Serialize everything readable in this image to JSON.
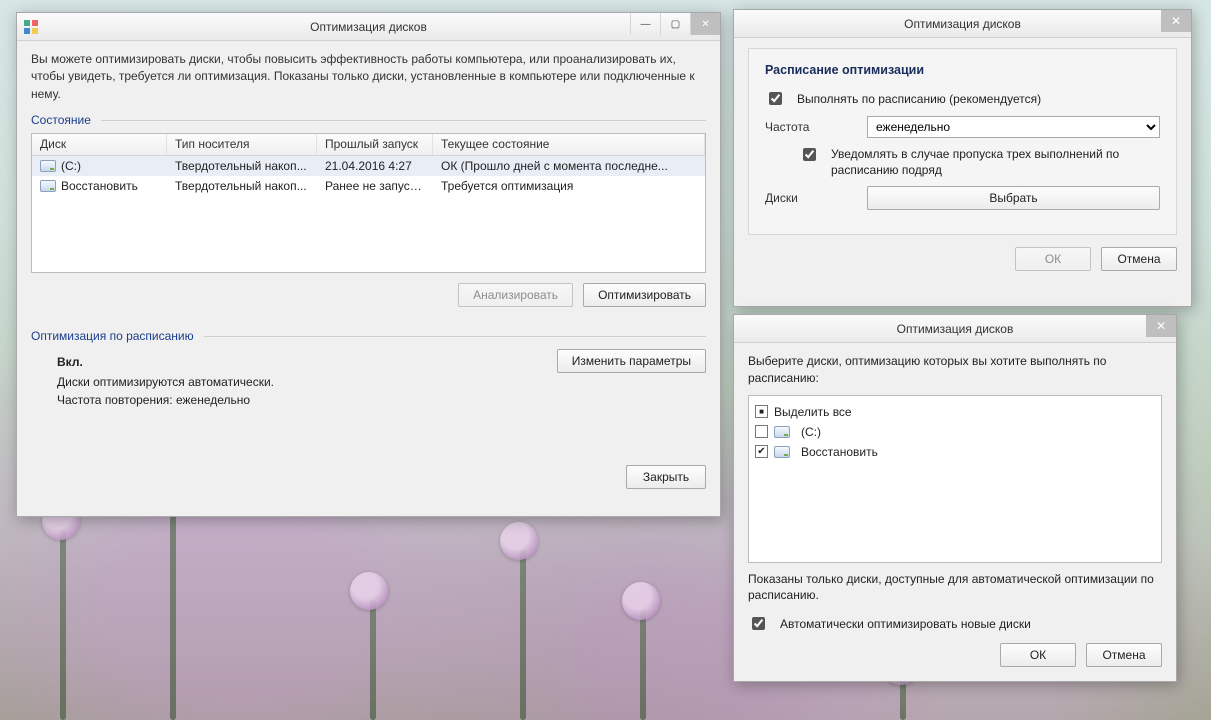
{
  "main": {
    "title": "Оптимизация дисков",
    "description": "Вы можете оптимизировать диски, чтобы повысить эффективность работы  компьютера, или проанализировать их, чтобы увидеть, требуется ли оптимизация. Показаны только диски, установленные в компьютере или подключенные к нему.",
    "state_label": "Состояние",
    "columns": {
      "c1": "Диск",
      "c2": "Тип носителя",
      "c3": "Прошлый запуск",
      "c4": "Текущее состояние"
    },
    "rows": [
      {
        "name": "(C:)",
        "type": "Твердотельный накоп...",
        "last": "21.04.2016 4:27",
        "status": "ОК (Прошло дней с момента последне...",
        "selected": true
      },
      {
        "name": "Восстановить",
        "type": "Твердотельный накоп...",
        "last": "Ранее не запуска...",
        "status": "Требуется оптимизация",
        "selected": false
      }
    ],
    "analyze_btn": "Анализировать",
    "optimize_btn": "Оптимизировать",
    "schedule_label": "Оптимизация по расписанию",
    "schedule_state": "Вкл.",
    "schedule_line1": "Диски оптимизируются автоматически.",
    "schedule_line2": "Частота повторения: еженедельно",
    "change_btn": "Изменить параметры",
    "close_btn": "Закрыть"
  },
  "schedule": {
    "title": "Оптимизация дисков",
    "heading": "Расписание оптимизации",
    "run_label": "Выполнять по расписанию (рекомендуется)",
    "freq_label": "Частота",
    "freq_value": "еженедельно",
    "notify_label": "Уведомлять в случае пропуска трех выполнений по расписанию подряд",
    "disks_label": "Диски",
    "choose_btn": "Выбрать",
    "ok_btn": "ОК",
    "cancel_btn": "Отмена"
  },
  "choose": {
    "title": "Оптимизация дисков",
    "prompt": "Выберите диски, оптимизацию которых вы хотите выполнять по расписанию:",
    "select_all": "Выделить все",
    "items": [
      {
        "name": "(C:)",
        "checked": false
      },
      {
        "name": "Восстановить",
        "checked": true
      }
    ],
    "note": "Показаны только диски, доступные для автоматической оптимизации по расписанию.",
    "auto_new": "Автоматически оптимизировать новые диски",
    "ok_btn": "ОК",
    "cancel_btn": "Отмена"
  }
}
